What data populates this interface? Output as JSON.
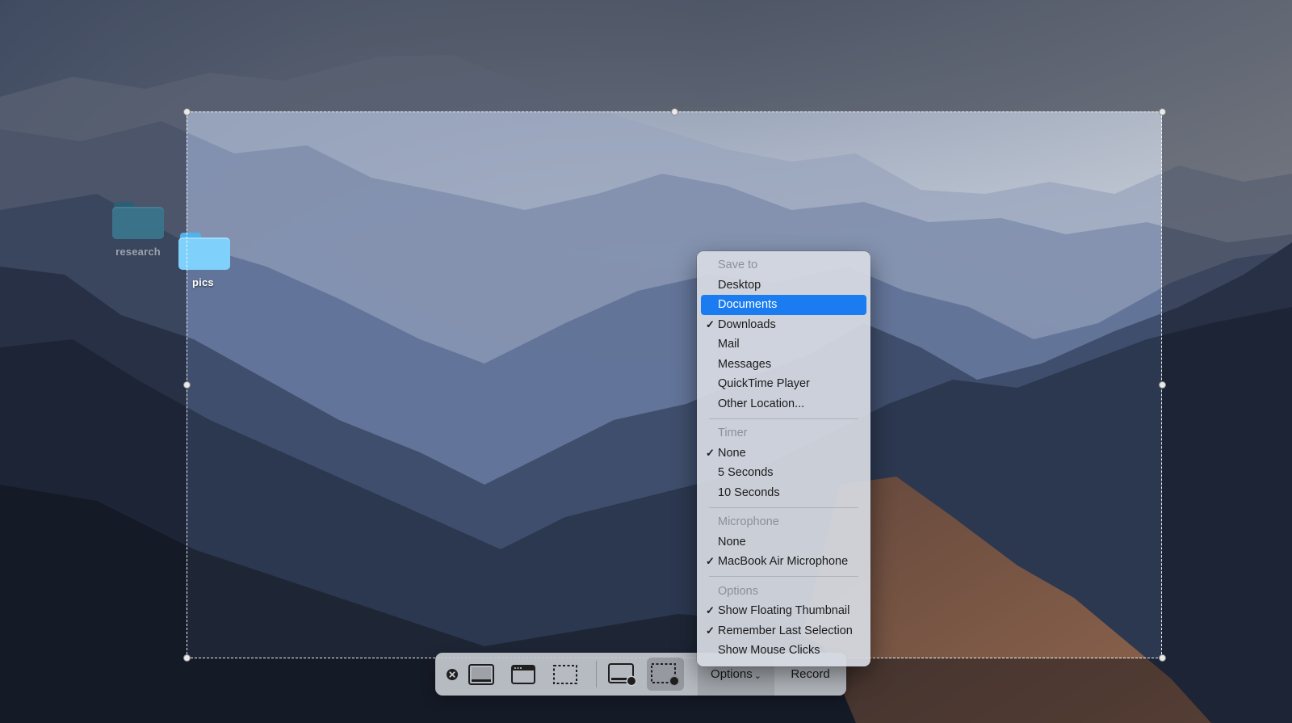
{
  "desktop": {
    "icons": [
      {
        "label": "research"
      },
      {
        "label": "pics"
      }
    ]
  },
  "menu": {
    "sections": [
      {
        "header": "Save to",
        "items": [
          {
            "label": "Desktop",
            "checked": false
          },
          {
            "label": "Documents",
            "checked": false,
            "highlighted": true
          },
          {
            "label": "Downloads",
            "checked": true
          },
          {
            "label": "Mail",
            "checked": false
          },
          {
            "label": "Messages",
            "checked": false
          },
          {
            "label": "QuickTime Player",
            "checked": false
          },
          {
            "label": "Other Location...",
            "checked": false
          }
        ]
      },
      {
        "header": "Timer",
        "items": [
          {
            "label": "None",
            "checked": true
          },
          {
            "label": "5 Seconds",
            "checked": false
          },
          {
            "label": "10 Seconds",
            "checked": false
          }
        ]
      },
      {
        "header": "Microphone",
        "items": [
          {
            "label": "None",
            "checked": false
          },
          {
            "label": "MacBook Air Microphone",
            "checked": true
          }
        ]
      },
      {
        "header": "Options",
        "items": [
          {
            "label": "Show Floating Thumbnail",
            "checked": true
          },
          {
            "label": "Remember Last Selection",
            "checked": true
          },
          {
            "label": "Show Mouse Clicks",
            "checked": false
          }
        ]
      }
    ],
    "check_glyph": "✓"
  },
  "toolbar": {
    "close_icon": "close-circle-icon",
    "tools": [
      {
        "icon": "capture-entire-screen-icon"
      },
      {
        "icon": "capture-selected-window-icon"
      },
      {
        "icon": "capture-selected-portion-icon"
      },
      {
        "icon": "record-entire-screen-icon"
      },
      {
        "icon": "record-selected-portion-icon",
        "active": true
      }
    ],
    "options_label": "Options",
    "options_chevron": "⌄",
    "record_label": "Record"
  },
  "colors": {
    "highlight": "#1a7cf0",
    "menu_background": "#d6dae2"
  }
}
